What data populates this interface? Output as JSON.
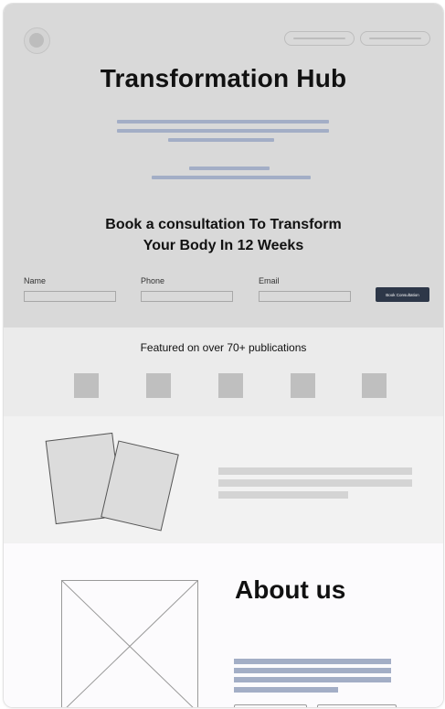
{
  "hero": {
    "title": "Transformation Hub",
    "subtitle_line1": "Book a consultation To Transform",
    "subtitle_line2": "Your Body In 12 Weeks"
  },
  "form": {
    "name_label": "Name",
    "phone_label": "Phone",
    "email_label": "Email",
    "submit_label": "Book Consultation"
  },
  "publications": {
    "title": "Featured on over 70+ publications"
  },
  "about": {
    "title": "About us"
  },
  "colors": {
    "hero_background": "#d9d9d9",
    "text_placeholder_bar": "#a3aec6",
    "cta_background": "#2d3748"
  }
}
